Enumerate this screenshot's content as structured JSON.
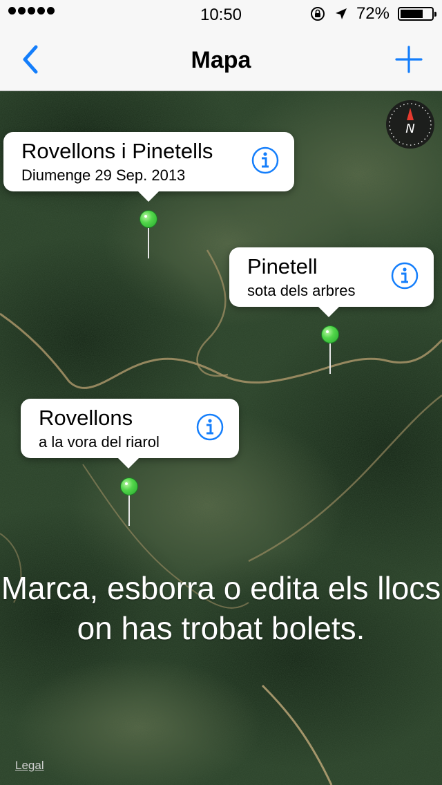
{
  "status_bar": {
    "signal_bars": 5,
    "time": "10:50",
    "battery_percent": "72%",
    "battery_level": 0.72
  },
  "nav": {
    "title": "Mapa",
    "back_icon": "chevron-left-icon",
    "add_icon": "plus-icon"
  },
  "map": {
    "compass_label": "N",
    "pins": [
      {
        "title": "Rovellons i Pinetells",
        "subtitle": "Diumenge 29 Sep. 2013"
      },
      {
        "title": "Pinetell",
        "subtitle": "sota dels arbres"
      },
      {
        "title": "Rovellons",
        "subtitle": "a la vora del riarol"
      }
    ],
    "overlay_text": "Marca, esborra o edita els llocs on has trobat bolets.",
    "legal": "Legal"
  },
  "colors": {
    "accent": "#147efb",
    "pin": "#4fd34a",
    "nav_bg": "#f7f7f7",
    "map_forest": "#233822"
  }
}
